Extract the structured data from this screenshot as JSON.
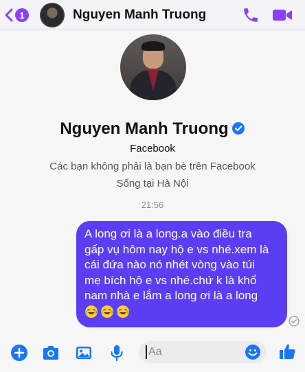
{
  "header": {
    "back_count": "1",
    "contact_name": "Nguyen Manh Truong"
  },
  "profile": {
    "name": "Nguyen Manh Truong",
    "subtitle": "Facebook",
    "info_friends": "Các bạn không phải là bạn bè trên Facebook",
    "info_location": "Sống tại Hà Nội"
  },
  "conversation": {
    "timestamp": "21:56",
    "message_lines": [
      "A long ơi là a long.a vào điều tra",
      "gấp vụ hôm nay hộ e vs nhé.xem là",
      "cái đứa nào nó nhét vòng vào túi",
      "mẹ bích hộ e vs nhé.chứ k là khổ",
      "nam nhà e lắm a long ơi là a long"
    ]
  },
  "composer": {
    "placeholder": "Aa"
  },
  "colors": {
    "accent": "#8a3ffc",
    "bubble": "#5b3df3",
    "composer_icons": "#1877f2"
  }
}
